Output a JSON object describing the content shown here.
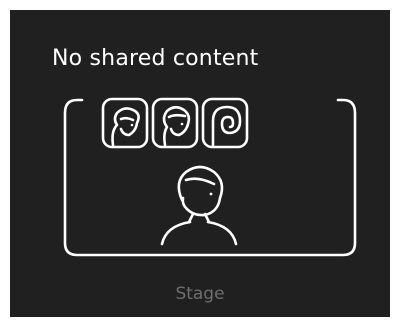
{
  "status": {
    "message": "No shared content"
  },
  "stage": {
    "label": "Stage"
  },
  "theme": {
    "background": "#202020",
    "stroke": "#ffffff",
    "label_color": "#6e6e6e"
  },
  "icons": {
    "stage_frame": "stage-frame-icon",
    "participants": [
      "participant-avatar-icon",
      "participant-avatar-icon",
      "participant-avatar-icon"
    ],
    "presenter": "presenter-avatar-icon"
  }
}
